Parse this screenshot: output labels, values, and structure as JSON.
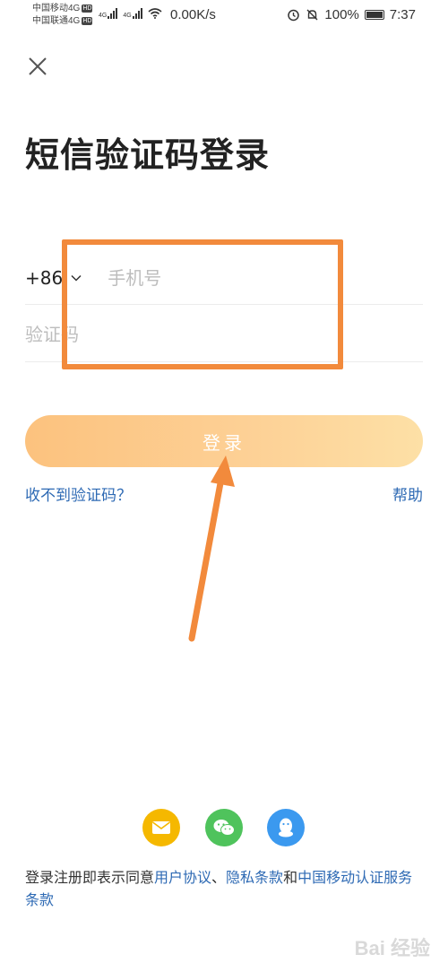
{
  "status_bar": {
    "carrier_1": "中国移动4G",
    "carrier_2": "中国联通4G",
    "hd_1": "HD",
    "hd_2": "HD",
    "sig_1": "4G",
    "sig_2": "4G",
    "net_speed": "0.00K/s",
    "battery_text": "100%",
    "time": "7:37"
  },
  "title": "短信验证码登录",
  "phone": {
    "country_code": "+86",
    "placeholder": "手机号"
  },
  "code": {
    "placeholder": "验证码"
  },
  "login_label": "登录",
  "no_code_label": "收不到验证码？",
  "help_label": "帮助",
  "social": {
    "mail": "mail-icon",
    "wechat": "wechat-icon",
    "qq": "qq-penguin-icon"
  },
  "agreement": {
    "prefix": "登录注册即表示同意",
    "user_agreement": "用户协议",
    "sep": "、",
    "privacy": "隐私条款",
    "and": "和",
    "cm_service": "中国移动认证服务条款"
  },
  "watermark": "Bai 经验",
  "colors": {
    "accent_orange": "#f28a3c",
    "login_gradient_start": "#fcc27e",
    "login_gradient_end": "#fde0a6",
    "link_blue": "#2e6ab4",
    "mail": "#f5b800",
    "wechat": "#4fc35c",
    "qq": "#3b99ef"
  }
}
